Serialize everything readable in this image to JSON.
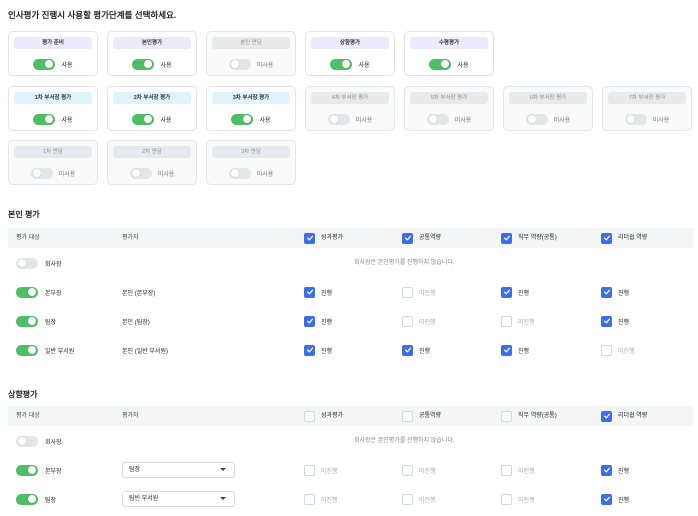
{
  "title": "인사평가 진행시 사용할 평가단계를 선택하세요.",
  "stages": [
    {
      "label": "평가 준비",
      "status": "사용",
      "on": true,
      "style": "purple"
    },
    {
      "label": "본인평가",
      "status": "사용",
      "on": true,
      "style": "purple"
    },
    {
      "label": "본인 면담",
      "status": "미사용",
      "on": false,
      "style": "gray"
    },
    {
      "label": "상향평가",
      "status": "사용",
      "on": true,
      "style": "purple"
    },
    {
      "label": "수평평가",
      "status": "사용",
      "on": true,
      "style": "purple"
    },
    {
      "label": "1차 부서장 평가",
      "status": "사용",
      "on": true,
      "style": "blue"
    },
    {
      "label": "2차 부서장 평가",
      "status": "사용",
      "on": true,
      "style": "blue"
    },
    {
      "label": "3차 부서장 평가",
      "status": "사용",
      "on": true,
      "style": "blue"
    },
    {
      "label": "4차 부서장 평가",
      "status": "미사용",
      "on": false,
      "style": "gray"
    },
    {
      "label": "5차 부서장 평가",
      "status": "미사용",
      "on": false,
      "style": "gray"
    },
    {
      "label": "6차 부서장 평가",
      "status": "미사용",
      "on": false,
      "style": "gray"
    },
    {
      "label": "7차 부서장 평가",
      "status": "미사용",
      "on": false,
      "style": "gray"
    },
    {
      "label": "1차 면담",
      "status": "미사용",
      "on": false,
      "style": "gray"
    },
    {
      "label": "2차 면담",
      "status": "미사용",
      "on": false,
      "style": "gray"
    },
    {
      "label": "3차 면담",
      "status": "미사용",
      "on": false,
      "style": "gray"
    }
  ],
  "self_eval": {
    "title": "본인 평가",
    "headers": {
      "target": "평가 대상",
      "evaluator": "평가자",
      "cols": [
        {
          "label": "성과평가",
          "checked": true
        },
        {
          "label": "공통역량",
          "checked": true
        },
        {
          "label": "직무 역량(공통)",
          "checked": true
        },
        {
          "label": "리더쉽 역량",
          "checked": true
        }
      ]
    },
    "rows": [
      {
        "target": "회사장",
        "on": false,
        "note": "회사장은 본인평가를 진행하지 않습니다."
      },
      {
        "target": "본부장",
        "on": true,
        "evaluator": "본인 (본부장)",
        "cells": [
          {
            "label": "진행",
            "checked": true
          },
          {
            "label": "미진행",
            "checked": false
          },
          {
            "label": "진행",
            "checked": true
          },
          {
            "label": "진행",
            "checked": true
          }
        ]
      },
      {
        "target": "팀장",
        "on": true,
        "evaluator": "본인 (팀장)",
        "cells": [
          {
            "label": "진행",
            "checked": true
          },
          {
            "label": "미진행",
            "checked": false
          },
          {
            "label": "미진행",
            "checked": false
          },
          {
            "label": "진행",
            "checked": true
          }
        ]
      },
      {
        "target": "일반 부서원",
        "on": true,
        "evaluator": "본인 (일반 부서원)",
        "cells": [
          {
            "label": "진행",
            "checked": true
          },
          {
            "label": "진행",
            "checked": true
          },
          {
            "label": "진행",
            "checked": true
          },
          {
            "label": "미진행",
            "checked": false
          }
        ]
      }
    ]
  },
  "upward_eval": {
    "title": "상향평가",
    "headers": {
      "target": "평가 대상",
      "evaluator": "평가자",
      "cols": [
        {
          "label": "성과평가",
          "checked": false
        },
        {
          "label": "공통역량",
          "checked": false
        },
        {
          "label": "직무 역량(공통)",
          "checked": false
        },
        {
          "label": "리더쉽 역량",
          "checked": true
        }
      ]
    },
    "rows": [
      {
        "target": "회사장",
        "on": false,
        "note": "회사장은 본인평가를 진행하지 않습니다."
      },
      {
        "target": "본부장",
        "on": true,
        "evaluator_select": "팀장",
        "cells": [
          {
            "label": "미진행",
            "checked": false
          },
          {
            "label": "미진행",
            "checked": false
          },
          {
            "label": "미진행",
            "checked": false
          },
          {
            "label": "진행",
            "checked": true
          }
        ]
      },
      {
        "target": "팀장",
        "on": true,
        "evaluator_select": "팀빈 부서원",
        "cells": [
          {
            "label": "미진행",
            "checked": false
          },
          {
            "label": "미진행",
            "checked": false
          },
          {
            "label": "미진행",
            "checked": false
          },
          {
            "label": "진행",
            "checked": true
          }
        ]
      }
    ]
  }
}
